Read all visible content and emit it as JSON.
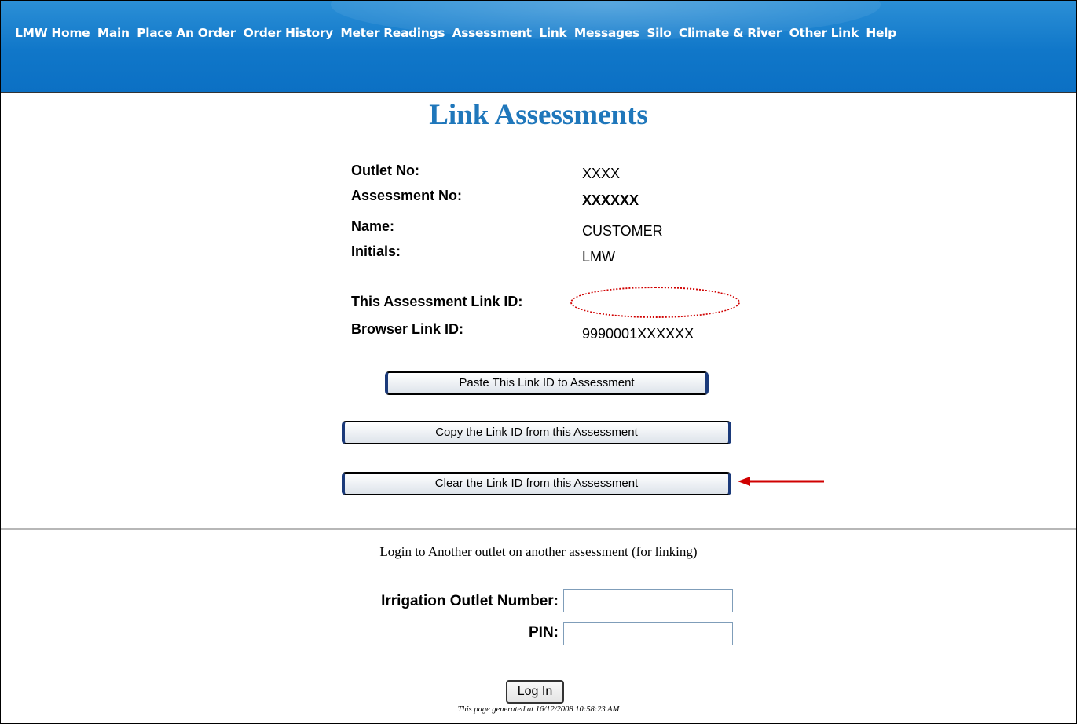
{
  "nav": {
    "items": [
      {
        "label": "LMW Home",
        "current": false
      },
      {
        "label": "Main",
        "current": false
      },
      {
        "label": "Place An Order",
        "current": false
      },
      {
        "label": "Order History",
        "current": false
      },
      {
        "label": "Meter Readings",
        "current": false
      },
      {
        "label": "Assessment",
        "current": false
      },
      {
        "label": "Link",
        "current": true
      },
      {
        "label": "Messages",
        "current": false
      },
      {
        "label": "Silo",
        "current": false
      },
      {
        "label": "Climate & River",
        "current": false
      },
      {
        "label": "Other Link",
        "current": false
      },
      {
        "label": "Help",
        "current": false
      }
    ]
  },
  "page": {
    "title": "Link Assessments"
  },
  "details": {
    "outlet_no": {
      "label": "Outlet No:",
      "value": "XXXX"
    },
    "assessment_no": {
      "label": "Assessment No:",
      "value": "XXXXXX"
    },
    "name": {
      "label": "Name:",
      "value": "CUSTOMER"
    },
    "initials": {
      "label": "Initials:",
      "value": "LMW"
    },
    "this_link_id": {
      "label": "This Assessment Link ID:",
      "value": ""
    },
    "browser_link_id": {
      "label": "Browser Link ID:",
      "value": "9990001XXXXXX"
    }
  },
  "buttons": {
    "paste": "Paste This Link ID to Assessment",
    "copy": "Copy the Link ID from this Assessment",
    "clear": "Clear the Link ID from this Assessment"
  },
  "login": {
    "heading": "Login to Another outlet on another assessment (for linking)",
    "outlet_label": "Irrigation Outlet Number:",
    "outlet_value": "",
    "pin_label": "PIN:",
    "pin_value": "",
    "button": "Log In"
  },
  "footer": "This page generated at 16/12/2008 10:58:23 AM",
  "colors": {
    "nav_bg": "#0b70c4",
    "title": "#1f77bb",
    "annotation": "#d00000"
  }
}
